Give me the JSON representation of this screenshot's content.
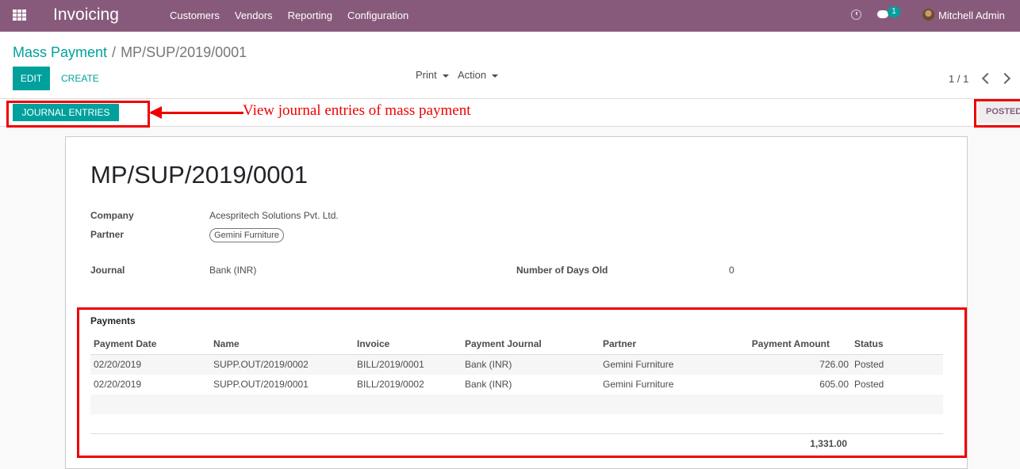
{
  "navbar": {
    "app_name": "Invoicing",
    "menu": [
      "Customers",
      "Vendors",
      "Reporting",
      "Configuration"
    ],
    "chat_count": "1",
    "user": "Mitchell Admin",
    "color": "#875a7b"
  },
  "breadcrumb": {
    "parent": "Mass Payment",
    "separator": "/",
    "current": "MP/SUP/2019/0001"
  },
  "buttons": {
    "edit": "EDIT",
    "create": "CREATE",
    "print": "Print",
    "action": "Action",
    "journal_entries": "JOURNAL ENTRIES"
  },
  "pager": {
    "value": "1 / 1"
  },
  "status": {
    "current": "POSTED"
  },
  "annotation": {
    "text": "View journal entries of mass payment"
  },
  "record": {
    "title": "MP/SUP/2019/0001",
    "company_label": "Company",
    "company": "Acespritech Solutions Pvt. Ltd.",
    "partner_label": "Partner",
    "partner": "Gemini Furniture",
    "journal_label": "Journal",
    "journal": "Bank (INR)",
    "days_old_label": "Number of Days Old",
    "days_old": "0"
  },
  "payments": {
    "title": "Payments",
    "columns": [
      "Payment Date",
      "Name",
      "Invoice",
      "Payment Journal",
      "Partner",
      "Payment Amount",
      "Status"
    ],
    "rows": [
      [
        "02/20/2019",
        "SUPP.OUT/2019/0002",
        "BILL/2019/0001",
        "Bank (INR)",
        "Gemini Furniture",
        "726.00",
        "Posted"
      ],
      [
        "02/20/2019",
        "SUPP.OUT/2019/0001",
        "BILL/2019/0002",
        "Bank (INR)",
        "Gemini Furniture",
        "605.00",
        "Posted"
      ]
    ],
    "total": "1,331.00"
  },
  "colors": {
    "accent": "#00a09d",
    "annotation": "#e00000"
  }
}
